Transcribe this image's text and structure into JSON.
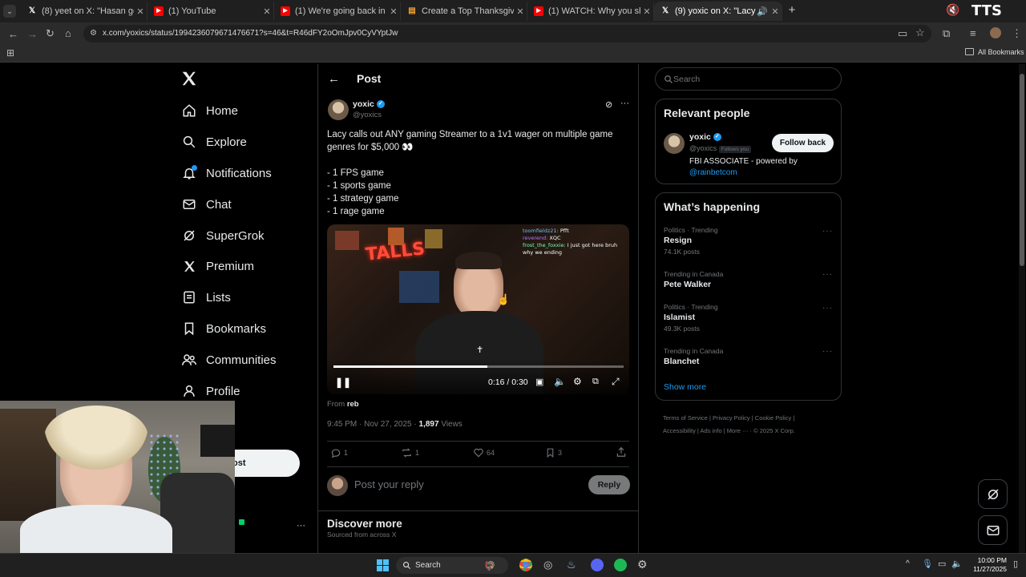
{
  "browser": {
    "tabs": [
      {
        "title": "(8) yeet on X: \"Hasan goes at it",
        "icon": "x-logo",
        "color": "#ffffff"
      },
      {
        "title": "(1) YouTube",
        "icon": "youtube-logo",
        "color": "#ff0000"
      },
      {
        "title": "(1) We're going back in time to",
        "icon": "youtube-logo",
        "color": "#ff0000"
      },
      {
        "title": "Create a Top Thanksgiving Foo",
        "icon": "page-icon",
        "color": "#f0a030"
      },
      {
        "title": "(1) WATCH: Why you shouldn't",
        "icon": "youtube-logo",
        "color": "#ff0000"
      },
      {
        "title": "(9) yoxic on X: \"Lacy calls o",
        "icon": "x-logo",
        "color": "#ffffff"
      }
    ],
    "url": "x.com/yoxics/status/1994236079671476671?s=46&t=R46dFY2oOmJpv0CyVYptJw",
    "all_bookmarks": "All Bookmarks",
    "overlay_text": "TTS"
  },
  "sidebar": {
    "items": [
      {
        "label": "Home",
        "icon": "home-icon"
      },
      {
        "label": "Explore",
        "icon": "search-icon"
      },
      {
        "label": "Notifications",
        "icon": "bell-icon"
      },
      {
        "label": "Chat",
        "icon": "mail-icon"
      },
      {
        "label": "SuperGrok",
        "icon": "grok-icon"
      },
      {
        "label": "Premium",
        "icon": "x-icon"
      },
      {
        "label": "Lists",
        "icon": "list-icon"
      },
      {
        "label": "Bookmarks",
        "icon": "bookmark-icon"
      },
      {
        "label": "Communities",
        "icon": "people-icon"
      },
      {
        "label": "Profile",
        "icon": "person-icon"
      }
    ],
    "post_button_partial": "ost",
    "more_dots": "···"
  },
  "post": {
    "header": "Post",
    "author_name": "yoxic",
    "author_handle": "@yoxics",
    "text_line1": "Lacy calls out ANY gaming Streamer to a 1v1 wager on multiple game genres for $5,000 👀",
    "list": [
      "- 1 FPS game",
      "- 1 sports game",
      "- 1 strategy game",
      "- 1 rage game"
    ],
    "video": {
      "time": "0:16 / 0:30",
      "progress": 0.53,
      "chat_lines": [
        {
          "user": "toomfieldz21:",
          "msg": "Pfft"
        },
        {
          "user": "reverend:",
          "msg": "XQC"
        },
        {
          "user": "frost_the_foxxie:",
          "msg": "I just got here bruh why we ending"
        }
      ],
      "neon_sign": "TALLS"
    },
    "from_label": "From",
    "from_name": "reb",
    "timestamp": "9:45 PM · Nov 27, 2025 · ",
    "views_count": "1,897",
    "views_label": " Views",
    "stats": {
      "replies": "1",
      "reposts": "1",
      "likes": "64",
      "bookmarks": "3"
    },
    "reply_placeholder": "Post your reply",
    "reply_button": "Reply",
    "discover_title": "Discover more",
    "discover_sub": "Sourced from across X"
  },
  "right": {
    "search_placeholder": "Search",
    "relevant_title": "Relevant people",
    "person_name": "yoxic",
    "person_handle": "@yoxics",
    "follows_you": "Follows you",
    "follow_back": "Follow back",
    "bio": "FBI ASSOCIATE - powered by",
    "bio_link": "@rainbetcom",
    "happening_title": "What’s happening",
    "trends": [
      {
        "meta": "Politics · Trending",
        "name": "Resign",
        "count": "74.1K posts"
      },
      {
        "meta": "Trending in Canada",
        "name": "Pete Walker",
        "count": ""
      },
      {
        "meta": "Politics · Trending",
        "name": "Islamist",
        "count": "49.3K posts"
      },
      {
        "meta": "Trending in Canada",
        "name": "Blanchet",
        "count": ""
      }
    ],
    "show_more": "Show more",
    "footer_links": [
      "Terms of Service",
      "Privacy Policy",
      "Cookie Policy",
      "Accessibility",
      "Ads info",
      "More ···",
      "© 2025 X Corp."
    ]
  },
  "taskbar": {
    "search": "Search",
    "time": "10:00 PM",
    "date": "11/27/2025"
  },
  "colors": {
    "accent": "#1d9bf0",
    "bg": "#000000",
    "border": "#2f3336",
    "muted": "#71767b"
  }
}
